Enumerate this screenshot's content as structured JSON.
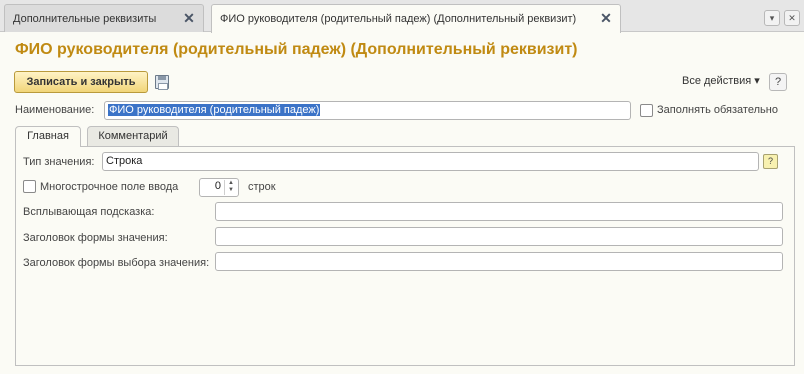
{
  "tabs": [
    {
      "label": "Дополнительные реквизиты",
      "close": "✕"
    },
    {
      "label": "ФИО руководителя (родительный падеж) (Дополнительный реквизит)",
      "close": "✕"
    }
  ],
  "strip_buttons": {
    "menu": "▾",
    "close": "✕"
  },
  "page_title": "ФИО руководителя (родительный падеж) (Дополнительный реквизит)",
  "toolbar": {
    "save_close_label": "Записать и закрыть",
    "all_actions_label": "Все действия ▾",
    "help_label": "?"
  },
  "name": {
    "label": "Наименование:",
    "value": "ФИО руководителя (родительный падеж)"
  },
  "required": {
    "label": "Заполнять обязательно",
    "checked": false
  },
  "inner_tabs": [
    "Главная",
    "Комментарий"
  ],
  "value_type": {
    "label": "Тип значения:",
    "value": "Строка",
    "hint": "?"
  },
  "multiline": {
    "label": "Многострочное поле ввода",
    "checked": false,
    "rows": "0",
    "unit": "строк"
  },
  "tooltip": {
    "label": "Всплывающая подсказка:",
    "value": ""
  },
  "form_title": {
    "label": "Заголовок формы значения:",
    "value": ""
  },
  "choice_form_title": {
    "label": "Заголовок формы выбора значения:",
    "value": ""
  }
}
